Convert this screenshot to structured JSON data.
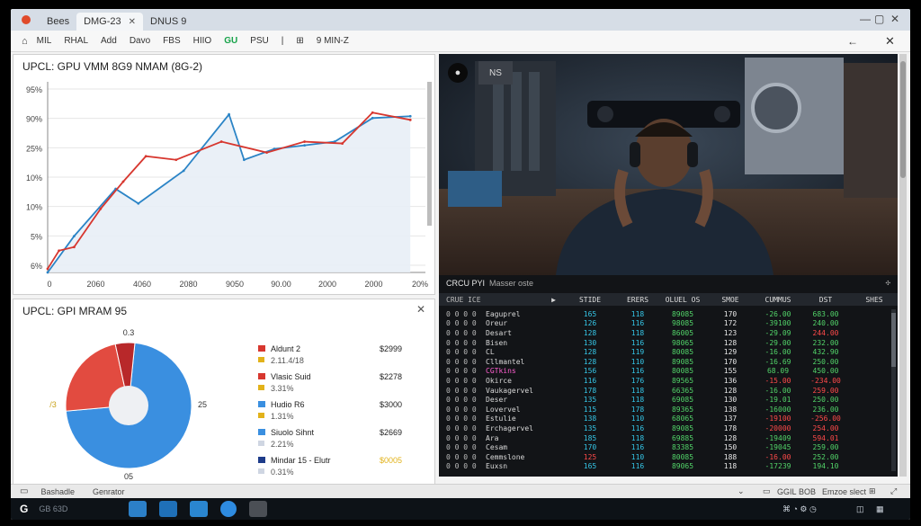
{
  "tabs": [
    {
      "label": "Bees",
      "active": false
    },
    {
      "label": "DMG-23",
      "active": true
    },
    {
      "label": "DNUS 9",
      "active": false
    }
  ],
  "toolbar": [
    "MIL",
    "RHAL",
    "Add",
    "Davo",
    "FBS",
    "HIIO",
    "GU",
    "PSU",
    "",
    "9 MIN-Z"
  ],
  "line_panel": {
    "title": "UPCL: GPU VMM 8G9 NMAM (8G-2)"
  },
  "pie_panel": {
    "title": "UPCL: GPI MRAM 95"
  },
  "video": {
    "btn_b": "NS"
  },
  "table": {
    "title": "CRCU PYI",
    "subtitle": "Masser oste",
    "headers": [
      "CRUE ICE",
      "",
      "STIDE",
      "ERERS",
      "OLUEL OS",
      "SMOE",
      "CUMMUS",
      "DST",
      "SHES"
    ],
    "rows": [
      [
        "0 0 0 0",
        "Eaguprel",
        "165",
        "118",
        "89085",
        "170",
        "-26.00",
        "683.00"
      ],
      [
        "0 0 0 0",
        "Oreur",
        "126",
        "116",
        "98085",
        "172",
        "-39100",
        "240.00"
      ],
      [
        "0 0 0 0",
        "Desart",
        "128",
        "118",
        "86005",
        "123",
        "-29.09",
        "244.00"
      ],
      [
        "0 0 0 0",
        "Bisen",
        "130",
        "116",
        "98065",
        "128",
        "-29.00",
        "232.00"
      ],
      [
        "0 0 0 0",
        "CL",
        "128",
        "119",
        "80085",
        "129",
        "-16.00",
        "432.90"
      ],
      [
        "0 0 0 0",
        "Cllmantel",
        "128",
        "110",
        "89085",
        "170",
        "-16.69",
        "250.00"
      ],
      [
        "0 0 0 0",
        "CGTkins",
        "156",
        "116",
        "80085",
        "155",
        "68.09",
        "450.00"
      ],
      [
        "0 0 0 0",
        "Okirce",
        "116",
        "176",
        "89565",
        "136",
        "-15.00",
        "-234.00"
      ],
      [
        "0 0 0 0",
        "Vaukagervel",
        "178",
        "118",
        "66365",
        "128",
        "-16.00",
        "259.00"
      ],
      [
        "0 0 0 0",
        "Deser",
        "135",
        "118",
        "69085",
        "130",
        "-19.01",
        "250.00"
      ],
      [
        "0 0 0 0",
        "Lovervel",
        "115",
        "178",
        "89365",
        "138",
        "-16000",
        "236.00"
      ],
      [
        "0 0 0 0",
        "Estulie",
        "138",
        "110",
        "68065",
        "137",
        "-19100",
        "-256.00"
      ],
      [
        "0 0 0 0",
        "Erchagervel",
        "135",
        "116",
        "89085",
        "178",
        "-20000",
        "254.00"
      ],
      [
        "0 0 0 0",
        "Ara",
        "185",
        "118",
        "69885",
        "128",
        "-19409",
        "594.01"
      ],
      [
        "0 0 0 0",
        "Cesam",
        "170",
        "116",
        "83385",
        "150",
        "-19045",
        "259.00"
      ],
      [
        "0 0 0 0",
        "Cemmslone",
        "125",
        "110",
        "80085",
        "188",
        "-16.00",
        "252.00"
      ],
      [
        "0 0 0 0",
        "Euxsn",
        "165",
        "116",
        "89065",
        "118",
        "-17239",
        "194.10"
      ]
    ]
  },
  "statusbar": {
    "left1": "Bashadle",
    "left2": "Genrator",
    "right1": "GGIL",
    "right2": "BOB",
    "right3": "Emzoe slect"
  },
  "taskbar": {
    "search": "GB 63D"
  },
  "colors": {
    "line_blue": "#2b84c6",
    "line_red": "#d7372f",
    "pie_blue": "#3a8fe0",
    "pie_red": "#e24b40",
    "pie_dark_red": "#b8282a"
  },
  "chart_data": [
    {
      "type": "line",
      "title": "UPCL: GPU VMM 8G9 NMAM (8G-2)",
      "yticks": [
        "95%",
        "90%",
        "25%",
        "10%",
        "10%",
        "5%",
        "6%"
      ],
      "xticks": [
        "0",
        "2060",
        "4060",
        "2080",
        "9050",
        "90.00",
        "2000",
        "2000",
        "20%"
      ],
      "series": [
        {
          "color": "blue",
          "points": [
            [
              0,
              0
            ],
            [
              0.07,
              0.2
            ],
            [
              0.18,
              0.46
            ],
            [
              0.24,
              0.38
            ],
            [
              0.36,
              0.56
            ],
            [
              0.48,
              0.87
            ],
            [
              0.52,
              0.62
            ],
            [
              0.6,
              0.68
            ],
            [
              0.68,
              0.7
            ],
            [
              0.76,
              0.72
            ],
            [
              0.86,
              0.85
            ],
            [
              0.96,
              0.86
            ]
          ]
        },
        {
          "color": "red",
          "points": [
            [
              0,
              0.02
            ],
            [
              0.03,
              0.12
            ],
            [
              0.07,
              0.14
            ],
            [
              0.14,
              0.35
            ],
            [
              0.2,
              0.5
            ],
            [
              0.26,
              0.64
            ],
            [
              0.34,
              0.62
            ],
            [
              0.46,
              0.72
            ],
            [
              0.58,
              0.66
            ],
            [
              0.68,
              0.72
            ],
            [
              0.78,
              0.71
            ],
            [
              0.86,
              0.88
            ],
            [
              0.96,
              0.84
            ]
          ]
        }
      ]
    },
    {
      "type": "pie",
      "title": "UPCL: GPI MRAM 95",
      "slices": [
        {
          "value": 72,
          "color": "#3a8fe0"
        },
        {
          "value": 23,
          "color": "#e24b40"
        },
        {
          "value": 5,
          "color": "#b8282a"
        }
      ],
      "labels": [
        "0.3",
        "/3",
        "25",
        "05"
      ],
      "legend": [
        {
          "name": "Aldunt 2",
          "sub": "2.11.4/18",
          "value": "$2999",
          "color": "#d7372f",
          "sub_color": "#e2b21a"
        },
        {
          "name": "Vlasic Suid",
          "sub": "3.31%",
          "value": "$2278",
          "color": "#d7372f",
          "sub_color": "#e2b21a"
        },
        {
          "name": "Hudio R6",
          "sub": "1.31%",
          "value": "$3000",
          "color": "#3a8fe0",
          "sub_color": "#e2b21a"
        },
        {
          "name": "Siuolo Sihnt",
          "sub": "2.21%",
          "value": "$2669",
          "color": "#3a8fe0",
          "sub_color": "#cfd6e2"
        },
        {
          "name": "Mindar 15 - Elutr",
          "sub": "0.31%",
          "value": "$0005",
          "color": "#1e3c8a",
          "sub_color": "#cfd6e2",
          "value_color": "#e2b21a"
        }
      ]
    }
  ]
}
